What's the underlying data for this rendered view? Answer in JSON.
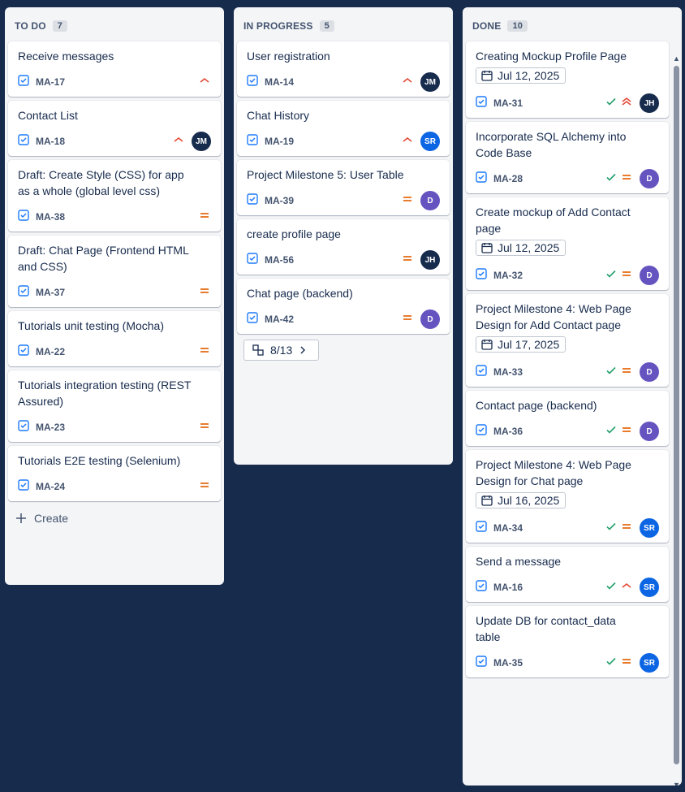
{
  "columns": [
    {
      "id": "todo",
      "title": "TO DO",
      "count": "7",
      "cards": [
        {
          "title": "Receive messages",
          "key": "MA-17",
          "priority": "medium-up",
          "avatar": null
        },
        {
          "title": "Contact List",
          "key": "MA-18",
          "priority": "medium-up",
          "avatar": {
            "initials": "JM",
            "color": "jm"
          }
        },
        {
          "title": "Draft: Create Style (CSS) for app as a whole (global level css)",
          "key": "MA-38",
          "priority": "medium",
          "avatar": null
        },
        {
          "title": "Draft: Chat Page (Frontend HTML and CSS)",
          "key": "MA-37",
          "priority": "medium",
          "avatar": null
        },
        {
          "title": "Tutorials unit testing (Mocha)",
          "key": "MA-22",
          "priority": "medium",
          "avatar": null
        },
        {
          "title": "Tutorials integration testing (REST Assured)",
          "key": "MA-23",
          "priority": "medium",
          "avatar": null
        },
        {
          "title": "Tutorials E2E testing (Selenium)",
          "key": "MA-24",
          "priority": "medium",
          "avatar": null
        }
      ],
      "create_label": "Create"
    },
    {
      "id": "inprogress",
      "title": "IN PROGRESS",
      "count": "5",
      "cards": [
        {
          "title": "User registration",
          "key": "MA-14",
          "priority": "medium-up",
          "avatar": {
            "initials": "JM",
            "color": "jm"
          }
        },
        {
          "title": "Chat History",
          "key": "MA-19",
          "priority": "medium-up",
          "avatar": {
            "initials": "SR",
            "color": "sr"
          }
        },
        {
          "title": "Project Milestone 5: User Table",
          "key": "MA-39",
          "priority": "medium",
          "avatar": {
            "initials": "D",
            "color": "d"
          }
        },
        {
          "title": "create profile page",
          "key": "MA-56",
          "priority": "medium",
          "avatar": {
            "initials": "JH",
            "color": "jh"
          }
        },
        {
          "title": "Chat page (backend)",
          "key": "MA-42",
          "priority": "medium",
          "avatar": {
            "initials": "D",
            "color": "d"
          }
        }
      ],
      "child_issues_label": "8/13"
    },
    {
      "id": "done",
      "title": "DONE",
      "count": "10",
      "cards": [
        {
          "title": "Creating Mockup Profile Page",
          "date": "Jul 12, 2025",
          "key": "MA-31",
          "done": true,
          "priority": "high",
          "avatar": {
            "initials": "JH",
            "color": "jh"
          }
        },
        {
          "title": "Incorporate SQL Alchemy into Code Base",
          "key": "MA-28",
          "done": true,
          "priority": "medium",
          "avatar": {
            "initials": "D",
            "color": "d"
          }
        },
        {
          "title": "Create mockup of Add Contact page",
          "date": "Jul 12, 2025",
          "key": "MA-32",
          "done": true,
          "priority": "medium",
          "avatar": {
            "initials": "D",
            "color": "d"
          }
        },
        {
          "title": "Project Milestone 4: Web Page Design for Add Contact page",
          "date": "Jul 17, 2025",
          "key": "MA-33",
          "done": true,
          "priority": "medium",
          "avatar": {
            "initials": "D",
            "color": "d"
          }
        },
        {
          "title": "Contact page (backend)",
          "key": "MA-36",
          "done": true,
          "priority": "medium",
          "avatar": {
            "initials": "D",
            "color": "d"
          }
        },
        {
          "title": "Project Milestone 4: Web Page Design for Chat page",
          "date": "Jul 16, 2025",
          "key": "MA-34",
          "done": true,
          "priority": "medium",
          "avatar": {
            "initials": "SR",
            "color": "sr"
          }
        },
        {
          "title": "Send a message",
          "key": "MA-16",
          "done": true,
          "priority": "medium-up",
          "avatar": {
            "initials": "SR",
            "color": "sr"
          }
        },
        {
          "title": "Update DB for contact_data table",
          "key": "MA-35",
          "done": true,
          "priority": "medium",
          "avatar": {
            "initials": "SR",
            "color": "sr"
          }
        }
      ]
    }
  ],
  "colors": {
    "background": "#172b4d",
    "priority_high": "#e34935",
    "priority_medium": "#e56910",
    "done_check": "#22a06b",
    "task_icon": "#1d7afc"
  },
  "icons": {
    "task": "checkbox-task-icon",
    "priority_medium": "equals-priority-icon",
    "priority_medium_up": "chevron-up-priority-icon",
    "priority_high": "double-chevron-up-priority-icon",
    "done": "checkmark-icon",
    "calendar": "calendar-icon",
    "create": "plus-icon",
    "child_issues": "child-issues-icon",
    "expand": "chevron-right-icon"
  }
}
